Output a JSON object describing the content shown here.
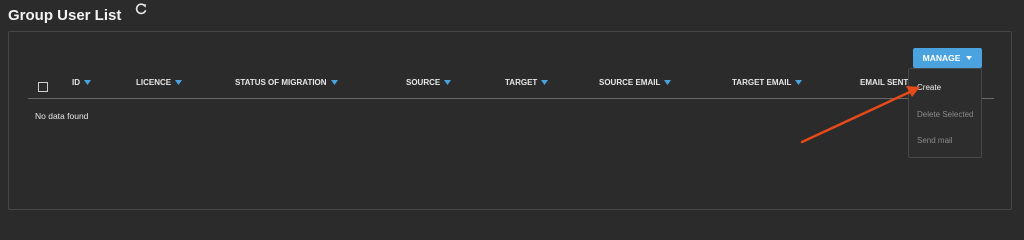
{
  "page": {
    "title": "Group User List"
  },
  "icons": {
    "refresh": "refresh-icon",
    "sort": "filter-funnel-icon",
    "dropdown": "caret-down-icon"
  },
  "colors": {
    "accent": "#4aa3df",
    "arrow": "#e64a19",
    "filter_icon": "#4aa3df",
    "disabled_text": "#8a8a8a"
  },
  "toolbar": {
    "manage_label": "MANAGE"
  },
  "table": {
    "columns": [
      "ID",
      "LICENCE",
      "STATUS OF MIGRATION",
      "SOURCE",
      "TARGET",
      "SOURCE EMAIL",
      "TARGET EMAIL",
      "EMAIL SENT"
    ],
    "rows": [],
    "empty_text": "No data found"
  },
  "manage_menu": {
    "items": [
      {
        "label": "Create",
        "enabled": true
      },
      {
        "label": "Delete Selected",
        "enabled": false
      },
      {
        "label": "Send mail",
        "enabled": false
      }
    ]
  }
}
